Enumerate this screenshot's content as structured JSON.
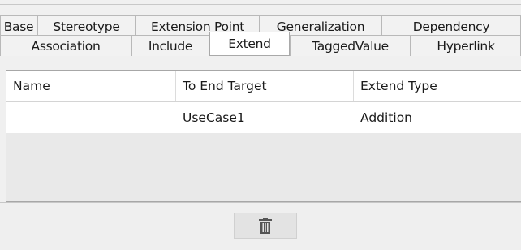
{
  "tabs": {
    "row1": [
      "Base",
      "Stereotype",
      "Extension Point",
      "Generalization",
      "Dependency"
    ],
    "row2": [
      "Association",
      "Include",
      "Extend",
      "TaggedValue",
      "Hyperlink"
    ],
    "selected": "Extend"
  },
  "table": {
    "columns": [
      "Name",
      "To End Target",
      "Extend Type"
    ],
    "rows": [
      [
        "",
        "UseCase1",
        "Addition"
      ]
    ]
  },
  "actions": {
    "delete_icon": "trash-icon"
  }
}
